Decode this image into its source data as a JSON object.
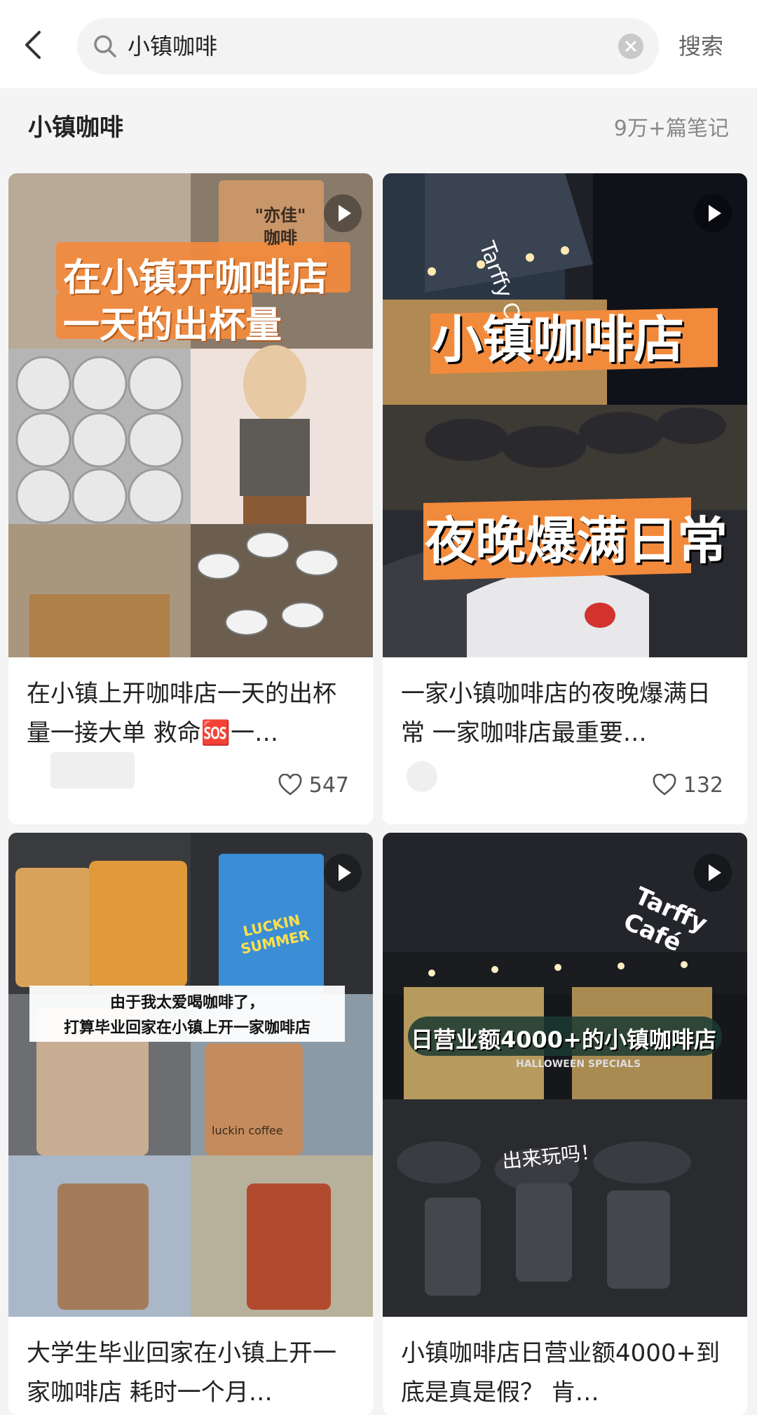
{
  "search": {
    "query": "小镇咖啡",
    "button_label": "搜索"
  },
  "results": {
    "title": "小镇咖啡",
    "count": "9万+篇笔记"
  },
  "notes": [
    {
      "title": "在小镇上开咖啡店一天的出杯量一接大单 救命🆘一…",
      "likes": "547",
      "overlay_lines": [
        "在小镇开咖啡店",
        "一天的出杯量"
      ],
      "sign_text": "\"亦佳\"\n咖啡"
    },
    {
      "title": "一家小镇咖啡店的夜晚爆满日常 一家咖啡店最重要…",
      "likes": "132",
      "overlay_lines": [
        "小镇咖啡店",
        "夜晚爆满日常"
      ]
    },
    {
      "title": "大学生毕业回家在小镇上开一家咖啡店 耗时一个月…",
      "overlay_lines": [
        "由于我太爱喝咖啡了，",
        "打算毕业回家在小镇上开一家咖啡店"
      ],
      "cup_texts": [
        "LUCKIN SUMMER",
        "luckin coffee"
      ]
    },
    {
      "title": "小镇咖啡店日营业额4000+到底是真是假？ 肯…",
      "overlay_lines": [
        "日营业额4000+的小镇咖啡店"
      ],
      "sign_text": "Tarffy Café",
      "sub_caption": "HALLOWEEN SPECIALS",
      "handwriting": "出来玩吗！"
    }
  ],
  "colors": {
    "accent_orange": "#f28a3c",
    "card_bg": "#ffffff",
    "page_bg": "#f4f4f4"
  }
}
